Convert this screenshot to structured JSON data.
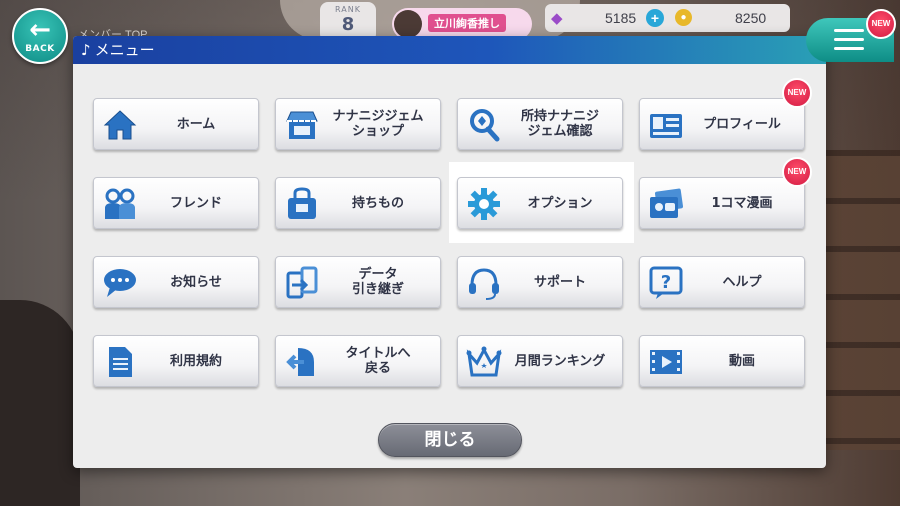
{
  "hud": {
    "back_label": "BACK",
    "member_label": "メンバー TOP",
    "rank_label": "RANK",
    "rank_value": "8",
    "oshi_name": "立川絢香推し",
    "gems": "5185",
    "coins": "8250",
    "new_badge": "NEW"
  },
  "dialog": {
    "title": "メニュー",
    "close_label": "閉じる",
    "items": [
      {
        "label": "ホーム",
        "icon": "home-icon"
      },
      {
        "label": "ナナニジジェム\nショップ",
        "icon": "shop-icon"
      },
      {
        "label": "所持ナナニジ\nジェム確認",
        "icon": "gem-check-icon"
      },
      {
        "label": "プロフィール",
        "icon": "profile-card-icon",
        "badge": "NEW"
      },
      {
        "label": "フレンド",
        "icon": "friends-icon"
      },
      {
        "label": "持ちもの",
        "icon": "bag-icon"
      },
      {
        "label": "オプション",
        "icon": "gear-icon",
        "highlighted": true
      },
      {
        "label": "1コマ漫画",
        "icon": "comic-icon",
        "badge": "NEW"
      },
      {
        "label": "お知らせ",
        "icon": "speech-bubble-icon"
      },
      {
        "label": "データ\n引き継ぎ",
        "icon": "data-transfer-icon"
      },
      {
        "label": "サポート",
        "icon": "headset-icon"
      },
      {
        "label": "ヘルプ",
        "icon": "help-icon"
      },
      {
        "label": "利用規約",
        "icon": "document-icon"
      },
      {
        "label": "タイトルへ\n戻る",
        "icon": "return-title-icon"
      },
      {
        "label": "月間ランキング",
        "icon": "crown-icon"
      },
      {
        "label": "動画",
        "icon": "video-icon"
      }
    ]
  },
  "colors": {
    "icon_blue": "#2a72c2",
    "header_start": "#1a40a0",
    "header_end": "#2aa0b6",
    "accent_teal": "#0e8d86",
    "new_red": "#d21b43"
  }
}
